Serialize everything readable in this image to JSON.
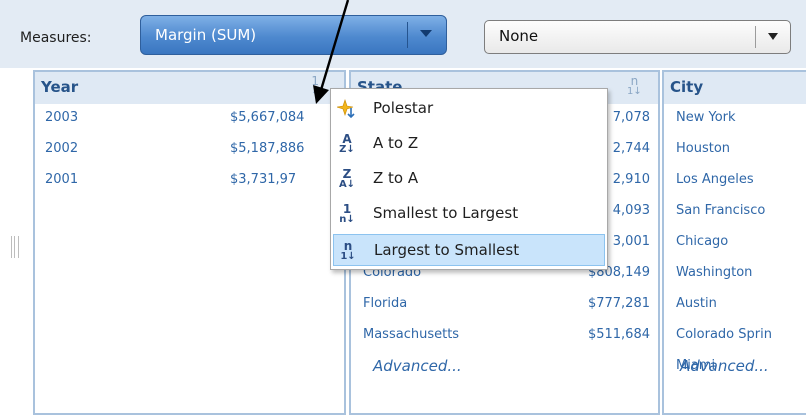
{
  "toolbar": {
    "measures_label": "Measures:",
    "measure_value": "Margin (SUM)",
    "secondary_value": "None"
  },
  "panels": {
    "year": {
      "title": "Year",
      "rows": [
        {
          "label": "2003",
          "value": "$5,667,084"
        },
        {
          "label": "2002",
          "value": "$5,187,886"
        },
        {
          "label": "2001",
          "value": "$3,731,97"
        }
      ]
    },
    "state": {
      "title": "State",
      "rows": [
        {
          "label": "",
          "value": "7,078"
        },
        {
          "label": "",
          "value": "2,744"
        },
        {
          "label": "",
          "value": "2,910"
        },
        {
          "label": "",
          "value": "4,093"
        },
        {
          "label": "",
          "value": "3,001"
        },
        {
          "label": "Colorado",
          "value": "$808,149"
        },
        {
          "label": "Florida",
          "value": "$777,281"
        },
        {
          "label": "Massachusetts",
          "value": "$511,684"
        }
      ],
      "advanced": "Advanced..."
    },
    "city": {
      "title": "City",
      "rows": [
        {
          "label": "New York"
        },
        {
          "label": "Houston"
        },
        {
          "label": "Los Angeles"
        },
        {
          "label": "San Francisco"
        },
        {
          "label": "Chicago"
        },
        {
          "label": "Washington"
        },
        {
          "label": "Austin"
        },
        {
          "label": "Colorado Sprin"
        },
        {
          "label": "Miami"
        }
      ],
      "advanced": "Advanced..."
    }
  },
  "sort_menu": {
    "items": [
      {
        "label": "Polestar",
        "icon": "polestar-sort-icon"
      },
      {
        "label": "A to Z",
        "icon": "sort-a-to-z-icon"
      },
      {
        "label": "Z to A",
        "icon": "sort-z-to-a-icon"
      },
      {
        "label": "Smallest to Largest",
        "icon": "sort-ascending-numeric-icon"
      },
      {
        "label": "Largest to Smallest",
        "icon": "sort-descending-numeric-icon"
      }
    ],
    "highlighted_index": 4
  },
  "colors": {
    "accent": "#4e89cf",
    "panel_border": "#a9c2dd",
    "link_text": "#2f67a8",
    "menu_highlight": "#c9e4fb"
  }
}
